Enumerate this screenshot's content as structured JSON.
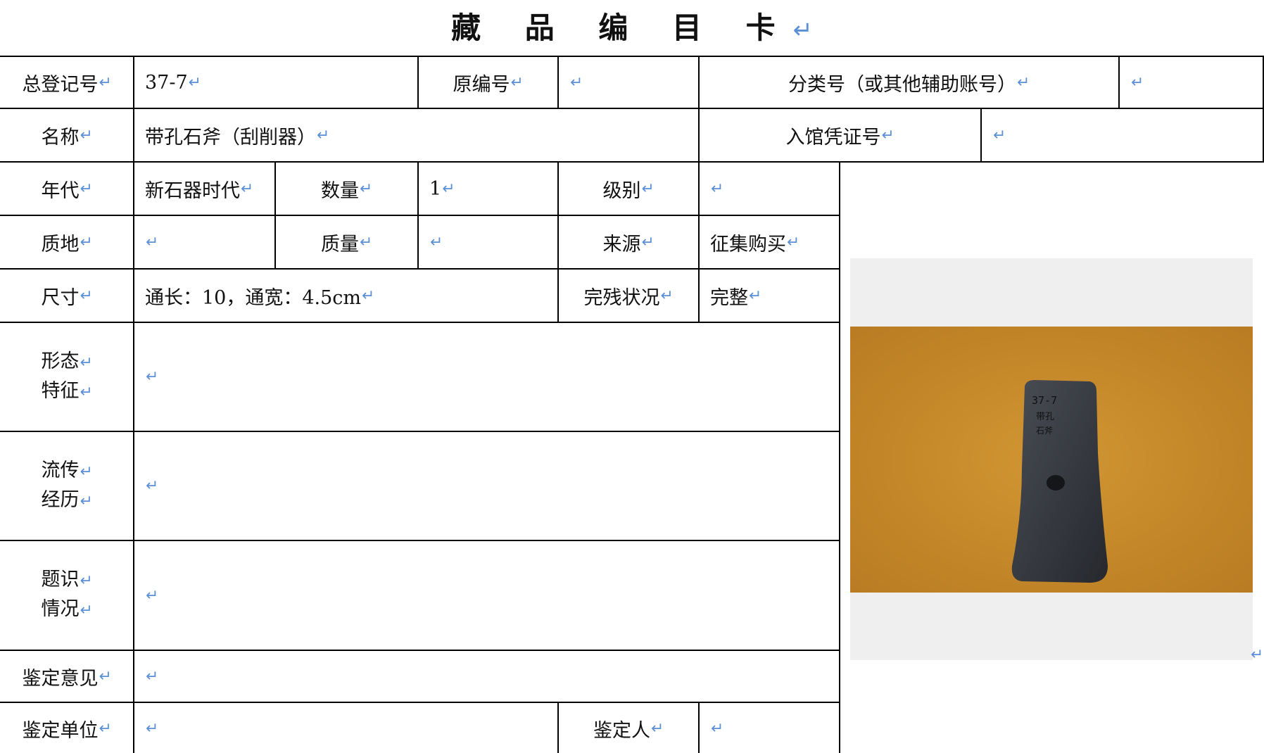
{
  "title": "藏 品 编 目 卡",
  "mark": "↵",
  "row1": {
    "reg_label": "总登记号",
    "reg_value": "37-7",
    "orig_label": "原编号",
    "orig_value": "",
    "class_label": "分类号（或其他辅助账号）",
    "class_value": ""
  },
  "row2": {
    "name_label": "名称",
    "name_value": "带孔石斧（刮削器）",
    "voucher_label": "入馆凭证号",
    "voucher_value": ""
  },
  "row3": {
    "era_label": "年代",
    "era_value": "新石器时代",
    "qty_label": "数量",
    "qty_value": "1",
    "grade_label": "级别",
    "grade_value": ""
  },
  "row4": {
    "material_label": "质地",
    "material_value": "",
    "mass_label": "质量",
    "mass_value": "",
    "source_label": "来源",
    "source_value": "征集购买"
  },
  "row5": {
    "size_label": "尺寸",
    "size_value": "通长：10，通宽：4.5cm",
    "condition_label": "完残状况",
    "condition_value": "完整"
  },
  "row6": {
    "label_1": "形态",
    "label_2": "特征",
    "value": ""
  },
  "row7": {
    "label_1": "流传",
    "label_2": "经历",
    "value": ""
  },
  "row8": {
    "label_1": "题识",
    "label_2": "情况",
    "value": ""
  },
  "row9": {
    "label": "鉴定意见",
    "value": ""
  },
  "row10": {
    "unit_label": "鉴定单位",
    "unit_value": "",
    "person_label": "鉴定人",
    "person_value": ""
  },
  "photo": {
    "inscription": [
      "37-7",
      "带孔",
      "石斧"
    ],
    "colors": {
      "background": "#c88a28",
      "stone": "#3a3d45",
      "panel": "#efefef"
    }
  }
}
